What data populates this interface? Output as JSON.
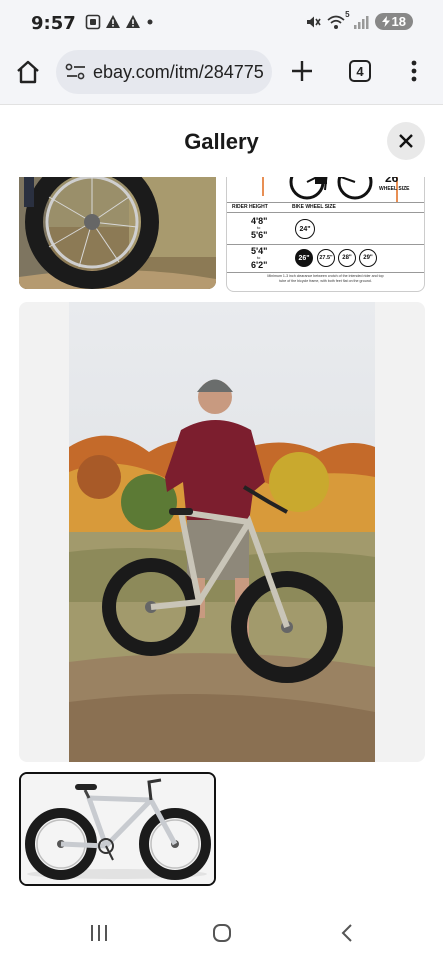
{
  "status_bar": {
    "time": "9:57",
    "battery_level": "18",
    "left_icons": [
      "screenshot-icon",
      "warning-icon",
      "warning-icon",
      "dot-icon"
    ],
    "right_icons": [
      "mute-icon",
      "wifi-icon",
      "signal-icon",
      "battery-icon"
    ],
    "wifi_label": "5"
  },
  "browser": {
    "url": "ebay.com/itm/284775",
    "tab_count": "4"
  },
  "gallery": {
    "title": "Gallery",
    "images": [
      {
        "name": "bike-wheel-closeup"
      },
      {
        "name": "size-chart",
        "wheel_size_value": "26\"",
        "wheel_size_label": "WHEEL SIZE",
        "col_rider_height": "RIDER HEIGHT",
        "col_bike_wheel_size": "BIKE WHEEL SIZE",
        "rows": [
          {
            "min": "4'8\"",
            "to": "to",
            "max": "5'6\"",
            "sizes": [
              "24\""
            ],
            "highlight": ""
          },
          {
            "min": "5'4\"",
            "to": "to",
            "max": "6'2\"",
            "sizes": [
              "26\"",
              "27.5\"",
              "28\"",
              "29\""
            ],
            "highlight": "26\""
          }
        ],
        "footnote_line1": "Minimum 1-3 inch clearance between crotch of the intended rider and top",
        "footnote_line2": "tube of the bicycle frame, with both feet flat on the ground."
      },
      {
        "name": "rider-with-fat-bike"
      },
      {
        "name": "silver-fat-bike-product",
        "selected": true
      }
    ]
  },
  "colors": {
    "chrome_bg": "#f4f5f8",
    "pill_bg": "#e6e8ee",
    "selected_border": "#111111"
  }
}
